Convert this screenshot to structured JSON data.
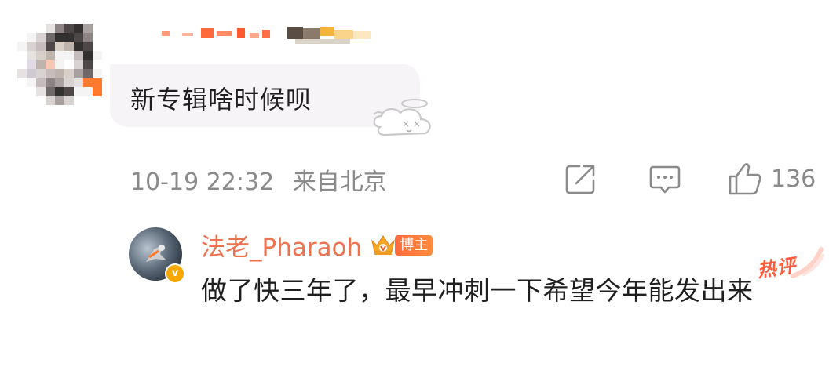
{
  "comment": {
    "text": "新专辑啥时候呗",
    "time": "10-19 22:32",
    "location": "来自北京",
    "like_count": "136",
    "icons": {
      "share": "share-icon",
      "comment": "comment-icon",
      "like": "thumbs-up-icon",
      "sticker": "dizzy-cloud-sticker-icon"
    }
  },
  "reply": {
    "username": "法老_Pharaoh",
    "host_badge": "博主",
    "hot_tag": "热评",
    "text": "做了快三年了，最早冲刺一下希望今年能发出来",
    "icons": {
      "crown": "vip-crown-icon",
      "verified": "verified-badge-icon"
    }
  },
  "colors": {
    "username_orange": "#eb7350",
    "meta_gray": "#8a8a8a",
    "bubble_bg": "#f7f4f8",
    "badge_orange": "#ff6a3d",
    "hot_red": "#ff5b3b"
  }
}
